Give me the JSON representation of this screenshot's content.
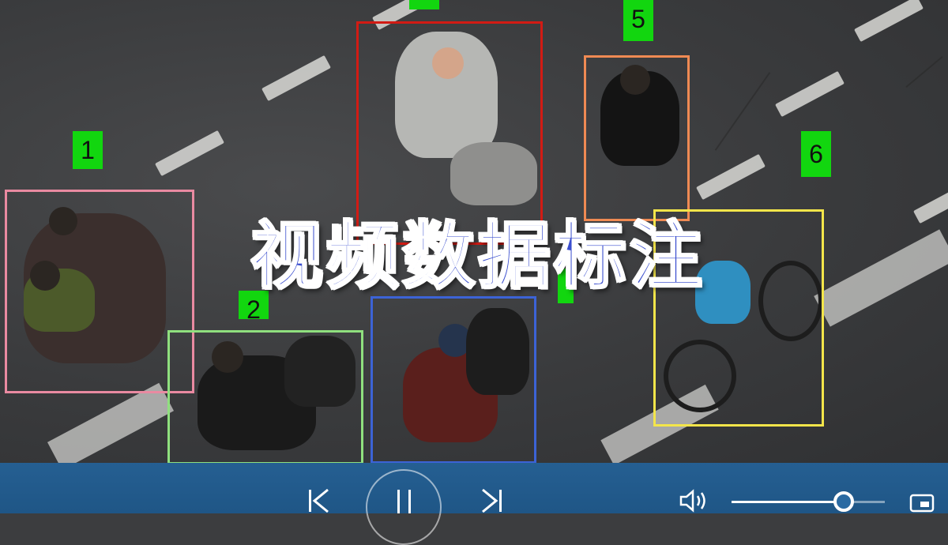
{
  "overlay": {
    "title": "视频数据标注"
  },
  "annotations": [
    {
      "id": "1",
      "color": "#e98aa1"
    },
    {
      "id": "2",
      "color": "#8fe07e"
    },
    {
      "id": "",
      "color": "#d21b14"
    },
    {
      "id": "",
      "color": "#3c63d6"
    },
    {
      "id": "5",
      "color": "#ef8a53"
    },
    {
      "id": "6",
      "color": "#f3e54a"
    }
  ],
  "player": {
    "prev_icon": "previous-track-icon",
    "pause_icon": "pause-icon",
    "next_icon": "next-track-icon",
    "volume_icon": "speaker-volume-icon",
    "volume_level": 0.73,
    "pip_icon": "picture-in-picture-icon",
    "accent": "#255f92"
  }
}
